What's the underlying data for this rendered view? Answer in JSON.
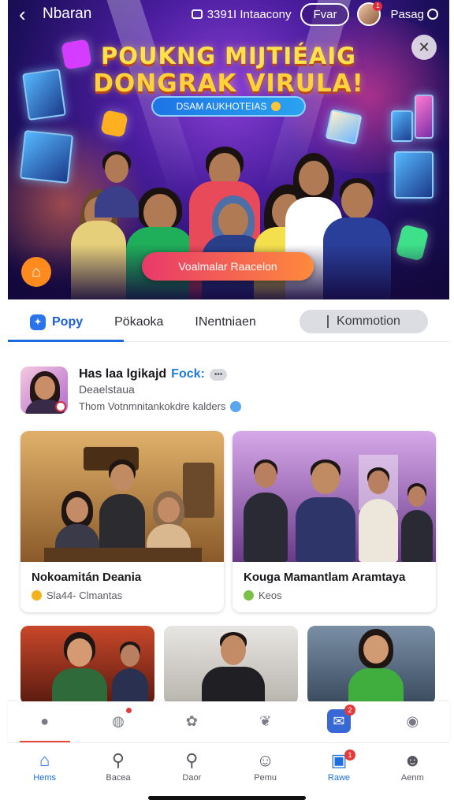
{
  "topbar": {
    "back_glyph": "‹",
    "title": "Nbaran",
    "status_text": "3391I Intaacony",
    "pill_label": "Fvar",
    "avatar_badge": "1",
    "tail_label": "Pasag"
  },
  "hero": {
    "headline_1": "POUKNG MIJTIÉAIG",
    "headline_2": "DONGRAK VIRULA!",
    "chip_label": "DSAM AUKHOTEIAS",
    "cta_label": "Voalmalar Raacelon",
    "home_glyph": "⌂",
    "close_glyph": "✕",
    "colors": {
      "cta_start": "#e8396b",
      "cta_end": "#ff8a3c",
      "chip": "#1d74e6"
    }
  },
  "tabs": {
    "items": [
      {
        "label": "Popy",
        "active": true
      },
      {
        "label": "Pökaoka",
        "active": false
      },
      {
        "label": "INentniaen",
        "active": false
      }
    ],
    "pill_label": "Kommotion"
  },
  "profile": {
    "name_prefix": "Has laa lgikajd",
    "name_highlight": "Fock:",
    "chip": "•••",
    "subtitle": "Deaelstaua",
    "meta": "Thom Votnmnitankokdre kalders"
  },
  "cards": [
    {
      "title": "Nokoamitán Deania",
      "meta": "Sla44- Clmantas",
      "dot_color": "#f2b21e"
    },
    {
      "title": "Kouga Mamantlam Aramtaya",
      "meta": "Keos",
      "dot_color": "#7cc04a"
    }
  ],
  "iconbar": {
    "icons": [
      {
        "name": "home-outline-icon",
        "glyph": "●",
        "badge": ""
      },
      {
        "name": "globe-icon",
        "glyph": "◍",
        "badge": "dot"
      },
      {
        "name": "paw-icon",
        "glyph": "✿",
        "badge": ""
      },
      {
        "name": "leaf-icon",
        "glyph": "❦",
        "badge": ""
      },
      {
        "name": "chat-icon",
        "glyph": "✉",
        "badge": "2"
      },
      {
        "name": "user-outline-icon",
        "glyph": "◉",
        "badge": ""
      }
    ]
  },
  "nav": {
    "items": [
      {
        "label": "Hems",
        "glyph": "⌂",
        "active": true,
        "badge": ""
      },
      {
        "label": "Bacea",
        "glyph": "⚲",
        "active": false,
        "badge": ""
      },
      {
        "label": "Daor",
        "glyph": "⚲",
        "active": false,
        "badge": ""
      },
      {
        "label": "Pemu",
        "glyph": "☺",
        "active": false,
        "badge": ""
      },
      {
        "label": "Rawe",
        "glyph": "▣",
        "active": true,
        "badge": "1"
      },
      {
        "label": "Aenm",
        "glyph": "☻",
        "active": false,
        "badge": ""
      }
    ]
  }
}
